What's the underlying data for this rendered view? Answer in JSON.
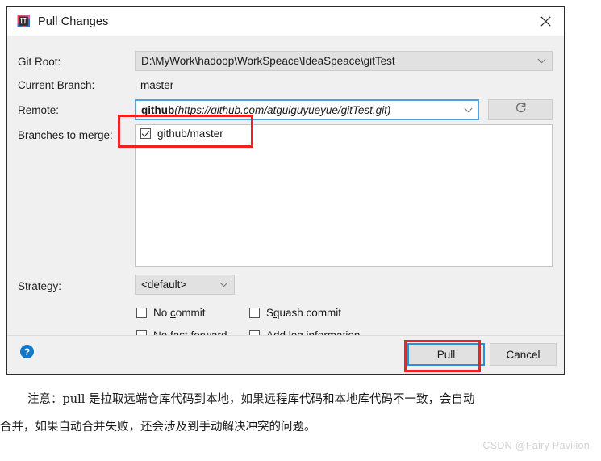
{
  "dialog": {
    "title": "Pull Changes",
    "icon": "intellij-idea-icon",
    "close_label": "×",
    "fields": {
      "git_root_label": "Git Root:",
      "git_root_value": "D:\\MyWork\\hadoop\\WorkSpeace\\IdeaSpeace\\gitTest",
      "current_branch_label": "Current Branch:",
      "current_branch_value": "master",
      "remote_label": "Remote:",
      "remote_name": "github",
      "remote_url": "(https://github.com/atguiguyueyue/gitTest.git)",
      "refresh_icon": "refresh-icon",
      "branches_label": "Branches to merge:",
      "strategy_label": "Strategy:",
      "strategy_value": "<default>"
    },
    "branches": [
      {
        "label": "github/master",
        "checked": true
      }
    ],
    "options": [
      {
        "id": "no-commit",
        "pre": "No ",
        "mnemonic": "c",
        "post": "ommit",
        "checked": false
      },
      {
        "id": "squash-commit",
        "pre": "S",
        "mnemonic": "q",
        "post": "uash commit",
        "checked": false
      },
      {
        "id": "no-fast-forward",
        "pre": "No ",
        "mnemonic": "f",
        "post": "ast forward",
        "checked": false
      },
      {
        "id": "add-log-information",
        "pre": "Add ",
        "mnemonic": "l",
        "post": "og information",
        "checked": false
      }
    ],
    "footer": {
      "help_glyph": "?",
      "pull_label": "Pull",
      "cancel_label": "Cancel"
    }
  },
  "annotations": {
    "accent_color": "#ef2020",
    "focus_color": "#2e8fdc"
  },
  "note": {
    "line1": "注意：pull 是拉取远端仓库代码到本地，如果远程库代码和本地库代码不一致，会自动",
    "line2": "合并，如果自动合并失败，还会涉及到手动解决冲突的问题。"
  },
  "watermark": "CSDN @Fairy Pavilion"
}
